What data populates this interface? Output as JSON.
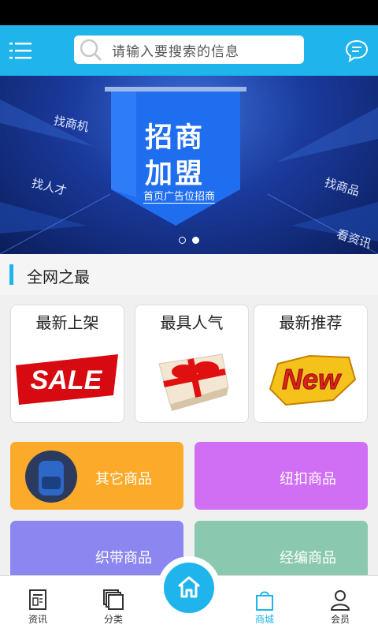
{
  "header": {
    "search_placeholder": "请输入要搜索的信息",
    "accent": "#1fb5ec"
  },
  "banner": {
    "title_line1": "招商",
    "title_line2": "加盟",
    "subtitle": "首页广告位招商",
    "tags": [
      "找商机",
      "找人才",
      "找商品",
      "看资讯"
    ],
    "active_dot": 2,
    "dot_count": 2
  },
  "section": {
    "title": "全网之最"
  },
  "cards": [
    {
      "title": "最新上架",
      "image": "sale-image",
      "image_text": "SALE"
    },
    {
      "title": "最具人气",
      "image": "gift-box-image"
    },
    {
      "title": "最新推荐",
      "image": "new-badge-image",
      "image_text": "New"
    }
  ],
  "tiles": [
    {
      "label": "其它商品",
      "color": "#fcaa2a"
    },
    {
      "label": "纽扣商品",
      "color": "#d06ef4"
    },
    {
      "label": "织带商品",
      "color": "#8c87f0"
    },
    {
      "label": "经编商品",
      "color": "#8ac9af"
    }
  ],
  "nav": {
    "items": [
      {
        "label": "资讯",
        "icon": "news-icon"
      },
      {
        "label": "分类",
        "icon": "category-icon"
      },
      {
        "label": "商城",
        "icon": "shopping-bag-icon"
      },
      {
        "label": "会员",
        "icon": "user-icon"
      }
    ],
    "home_icon": "home-icon",
    "active_color": "#1fb5ec"
  }
}
